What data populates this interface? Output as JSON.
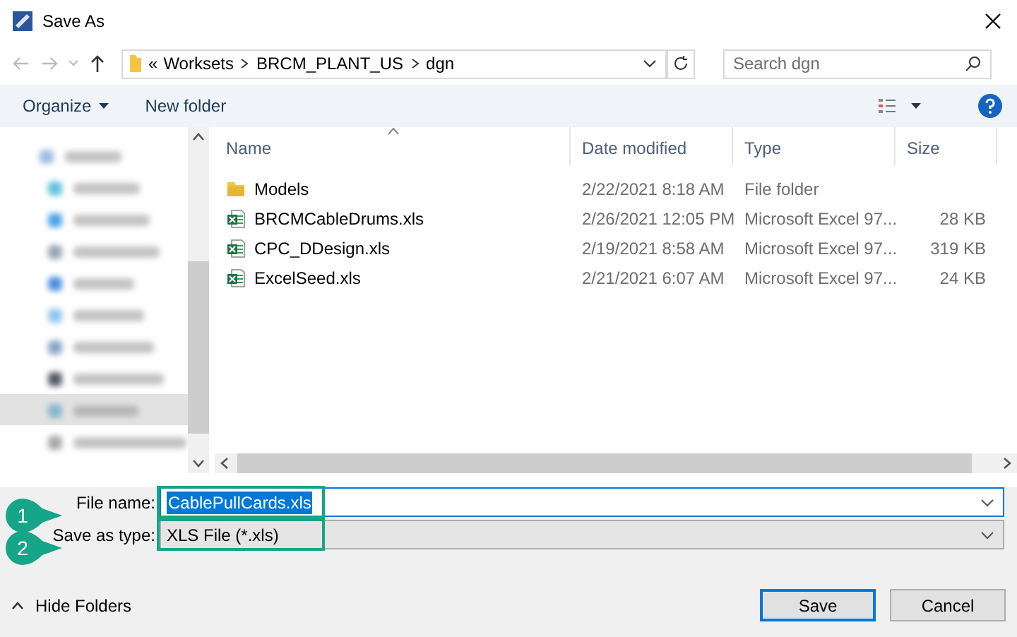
{
  "window": {
    "title": "Save As"
  },
  "address": {
    "overflow": "«",
    "breadcrumbs": [
      "Worksets",
      "BRCM_PLANT_US",
      "dgn"
    ]
  },
  "search": {
    "placeholder": "Search dgn"
  },
  "toolbar": {
    "organize": "Organize",
    "new_folder": "New folder"
  },
  "table": {
    "columns": [
      {
        "label": "Name",
        "sorted": true
      },
      {
        "label": "Date modified",
        "sorted": false
      },
      {
        "label": "Type",
        "sorted": false
      },
      {
        "label": "Size",
        "sorted": false
      }
    ],
    "rows": [
      {
        "kind": "folder",
        "name": "Models",
        "date": "2/22/2021 8:18 AM",
        "type": "File folder",
        "size": ""
      },
      {
        "kind": "excel",
        "name": "BRCMCableDrums.xls",
        "date": "2/26/2021 12:05 PM",
        "type": "Microsoft Excel 97...",
        "size": "28 KB"
      },
      {
        "kind": "excel",
        "name": "CPC_DDesign.xls",
        "date": "2/19/2021 8:58 AM",
        "type": "Microsoft Excel 97...",
        "size": "319 KB"
      },
      {
        "kind": "excel",
        "name": "ExcelSeed.xls",
        "date": "2/21/2021 6:07 AM",
        "type": "Microsoft Excel 97...",
        "size": "24 KB"
      }
    ]
  },
  "form": {
    "file_name": {
      "label": "File name:",
      "value": "CablePullCards.xls",
      "selected": true
    },
    "file_type": {
      "label": "Save as type:",
      "value": "XLS File (*.xls)"
    }
  },
  "callouts": [
    {
      "number": "1"
    },
    {
      "number": "2"
    }
  ],
  "hide_folders": "Hide Folders",
  "buttons": [
    {
      "label": "Save",
      "default": true
    },
    {
      "label": "Cancel",
      "default": false
    }
  ]
}
